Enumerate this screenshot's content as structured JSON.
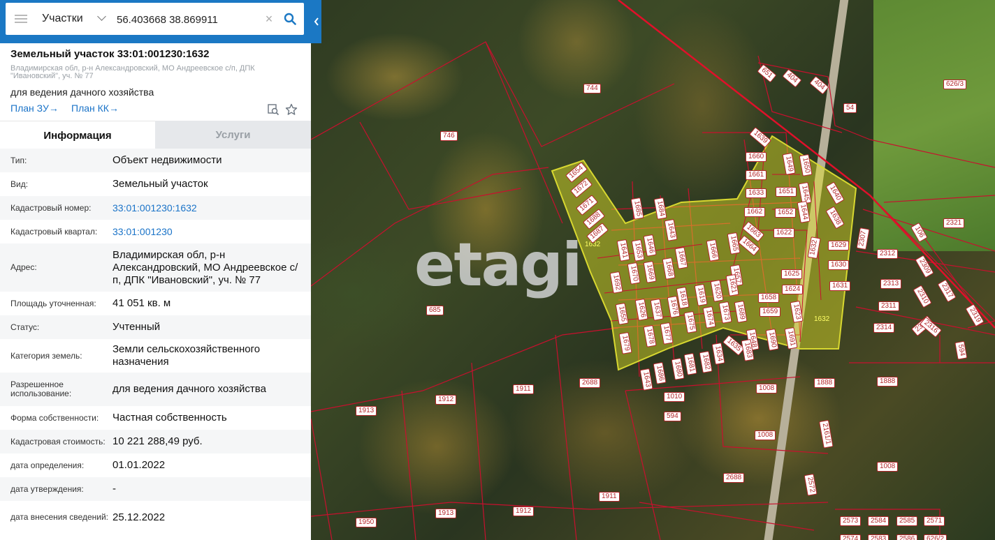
{
  "search": {
    "layer": "Участки",
    "query": "56.403668 38.869911",
    "clear_symbol": "×"
  },
  "parcel": {
    "title": "Земельный участок 33:01:001230:1632",
    "address_short": "Владимирская обл, р-н Александровский, МО Андреевское с/п, ДПК \"Ивановский\", уч. № 77",
    "purpose": "для ведения дачного хозяйства",
    "plan_zu": "План ЗУ→",
    "plan_kk": "План КК→"
  },
  "tabs": [
    {
      "label": "Информация",
      "active": true
    },
    {
      "label": "Услуги",
      "active": false
    }
  ],
  "info": [
    {
      "key": "Тип:",
      "value": "Объект недвижимости"
    },
    {
      "key": "Вид:",
      "value": "Земельный участок"
    },
    {
      "key": "Кадастровый номер:",
      "value": "33:01:001230:1632",
      "link": true
    },
    {
      "key": "Кадастровый квартал:",
      "value": "33:01:001230",
      "link": true
    },
    {
      "key": "Адрес:",
      "value": "Владимирская обл, р-н Александровский, МО Андреевское с/п, ДПК \"Ивановский\", уч. № 77"
    },
    {
      "key": "Площадь уточненная:",
      "value": "41 051 кв. м"
    },
    {
      "key": "Статус:",
      "value": "Учтенный"
    },
    {
      "key": "Категория земель:",
      "value": "Земли сельскохозяйственного назначения"
    },
    {
      "key": "Разрешенное использование:",
      "value": "для ведения дачного хозяйства"
    },
    {
      "key": "Форма собственности:",
      "value": "Частная собственность"
    },
    {
      "key": "Кадастровая стоимость:",
      "value": "10 221 288,49 руб."
    },
    {
      "key": "дата определения:",
      "value": "01.01.2022"
    },
    {
      "key": "дата утверждения:",
      "value": "-"
    },
    {
      "key": "дата внесения сведений:",
      "value": "25.12.2022"
    }
  ],
  "map": {
    "watermark": "etagi",
    "highlight_label": "1632",
    "parcel_labels": [
      "651",
      "404",
      "404",
      "54",
      "744",
      "746",
      "1639",
      "1660",
      "1649",
      "1650",
      "1654",
      "1661",
      "1651",
      "1645",
      "1640",
      "1672",
      "1633",
      "1652",
      "1638",
      "1671",
      "1662",
      "1644",
      "1688",
      "1685",
      "1684",
      "1687",
      "1663",
      "1622",
      "1629",
      "1632",
      "1641",
      "1653",
      "1643",
      "1646",
      "1667",
      "1666",
      "1665",
      "1664",
      "1630",
      "1625",
      "1657",
      "1692",
      "1670",
      "1669",
      "1668",
      "1631",
      "1624",
      "1618",
      "1619",
      "1620",
      "1621",
      "1658",
      "1659",
      "1623",
      "1655",
      "1626",
      "1637",
      "1676",
      "1675",
      "1674",
      "1673",
      "1635",
      "1648",
      "1690",
      "1691",
      "1679",
      "1678",
      "1677",
      "1634",
      "1686",
      "1680",
      "1681",
      "1682",
      "1689",
      "1683",
      "1643",
      "1010",
      "2688",
      "1911",
      "1912",
      "1913",
      "685",
      "594",
      "1008",
      "1008",
      "1888",
      "1888",
      "1008",
      "2161/1",
      "2307",
      "2312",
      "2309",
      "2313",
      "2310",
      "2311",
      "2314",
      "2315",
      "2316",
      "2317",
      "2319",
      "594",
      "2688",
      "1911",
      "1912",
      "1913",
      "1950",
      "2572",
      "2573",
      "2584",
      "2585",
      "2571",
      "2574",
      "2583",
      "2586",
      "626/2",
      "626/3",
      "2321",
      "106"
    ]
  }
}
